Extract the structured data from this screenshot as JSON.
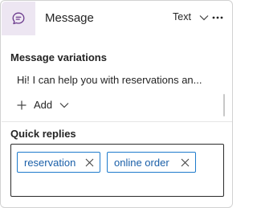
{
  "header": {
    "icon": "chat-message-icon",
    "title": "Message",
    "type_select_value": "Text",
    "more_icon": "more-horizontal-icon"
  },
  "variations": {
    "title": "Message variations",
    "items": [
      "Hi! I can help you with reservations an..."
    ],
    "add_label": "Add"
  },
  "quick_replies": {
    "title": "Quick replies",
    "chips": [
      {
        "label": "reservation"
      },
      {
        "label": "online order"
      }
    ]
  },
  "colors": {
    "header_icon_bg": "#ede6f2",
    "icon_purple": "#6b3a8c",
    "chip_border": "#1e7bcc",
    "chip_text": "#1a5fa8"
  }
}
